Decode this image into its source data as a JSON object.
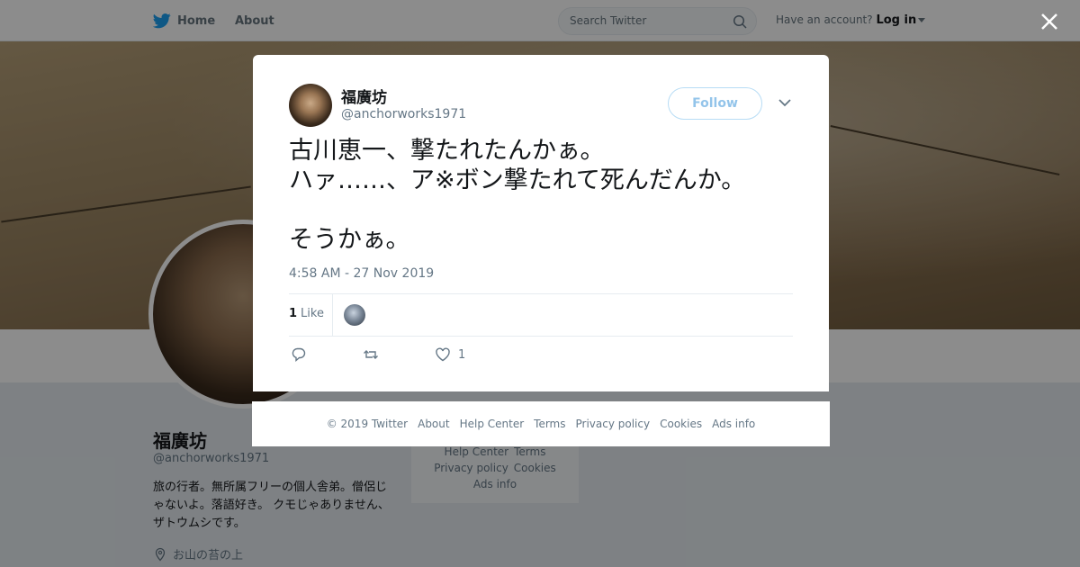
{
  "header": {
    "nav": [
      {
        "label": "Home"
      },
      {
        "label": "About"
      }
    ],
    "search_placeholder": "Search Twitter",
    "account_prompt": "Have an account?",
    "login_label": "Log in"
  },
  "profile": {
    "name": "福廣坊",
    "handle": "@anchorworks1971",
    "bio": "旅の行者。無所属フリーの個人舎弟。僧侶じゃないよ。落語好き。 クモじゃありません、ザトウムシです。",
    "location": "お山の苔の上"
  },
  "side_footer": {
    "links": [
      "Help Center",
      "Terms",
      "Privacy policy",
      "Cookies",
      "Ads info"
    ]
  },
  "tweet": {
    "author_name": "福廣坊",
    "author_handle": "@anchorworks1971",
    "follow_label": "Follow",
    "text": "古川恵一、撃たれたんかぁ。\nハァ……、ア※ボン撃たれて死んだんか。\n\nそうかぁ。",
    "timestamp": "4:58 AM - 27 Nov 2019",
    "like_count": "1",
    "like_label": "Like",
    "action_like_count": "1"
  },
  "footer": {
    "copyright": "© 2019 Twitter",
    "links": [
      "About",
      "Help Center",
      "Terms",
      "Privacy policy",
      "Cookies",
      "Ads info"
    ]
  },
  "colors": {
    "twitter_blue": "#1da1f2",
    "follow_border": "#b7dcf5",
    "muted_text": "#657786"
  }
}
